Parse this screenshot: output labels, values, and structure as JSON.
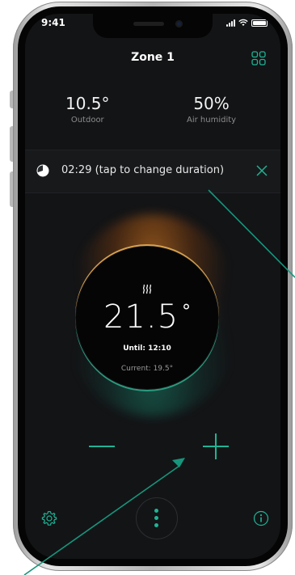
{
  "status_bar": {
    "time": "9:41"
  },
  "header": {
    "title": "Zone 1"
  },
  "metrics": {
    "outdoor": {
      "value": "10.5°",
      "label": "Outdoor"
    },
    "humidity": {
      "value": "50%",
      "label": "Air humidity"
    }
  },
  "duration": {
    "text": "02:29  (tap to change duration)"
  },
  "dial": {
    "temperature": "21.5",
    "degree": "°",
    "until": "Until: 12:10",
    "current": "Current: 19.5°"
  },
  "colors": {
    "accent": "#1fb495",
    "warm_glow": "#f0821e",
    "background": "#131416"
  },
  "icons": {
    "grid": "grid-icon",
    "clock": "clock-icon",
    "close": "close-icon",
    "heat": "heating-icon",
    "minus": "minus-icon",
    "plus": "plus-icon",
    "settings": "gear-icon",
    "menu": "more-vertical-icon",
    "info": "info-icon"
  }
}
